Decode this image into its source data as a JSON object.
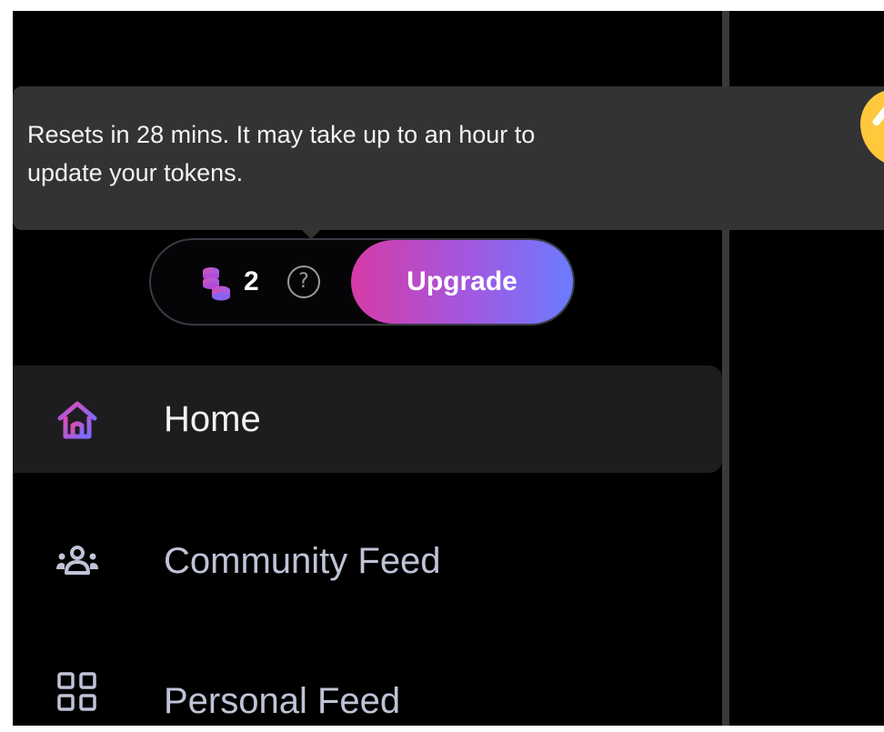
{
  "tooltip": {
    "line1": "Resets in 28 mins. It may take up to an hour to",
    "line2": "update your tokens."
  },
  "tokens": {
    "count": "2",
    "help_glyph": "?",
    "upgrade_label": "Upgrade",
    "icon": "coins-icon"
  },
  "nav": {
    "items": [
      {
        "label": "Home",
        "icon": "home-icon",
        "active": true
      },
      {
        "label": "Community Feed",
        "icon": "users-icon",
        "active": false
      },
      {
        "label": "Personal Feed",
        "icon": "grid-icon",
        "active": false
      }
    ]
  },
  "colors": {
    "background": "#000000",
    "tooltip_bg": "#333333",
    "upgrade_gradient_start": "#d63ba6",
    "upgrade_gradient_end": "#6b7cff",
    "accent_yellow": "#ffc83d",
    "nav_active_bg": "#1d1d20"
  }
}
